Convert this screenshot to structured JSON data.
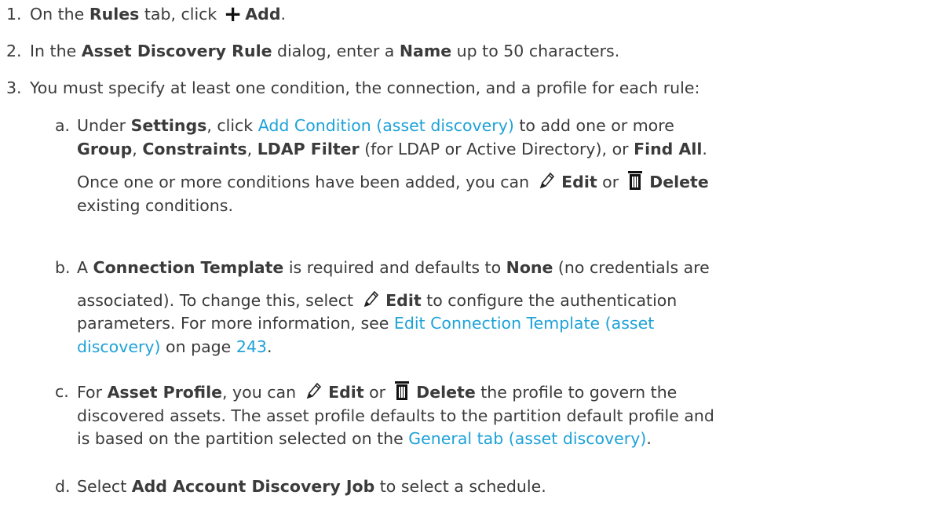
{
  "steps": [
    {
      "num": "1.",
      "pre": "On the ",
      "tab": "Rules",
      "mid": " tab, click ",
      "icon": "plus-icon",
      "action": "Add",
      "post": "."
    },
    {
      "num": "2.",
      "pre": "In the ",
      "dialog": "Asset Discovery Rule",
      "mid": " dialog, enter a ",
      "field": "Name",
      "post": " up to 50 characters."
    },
    {
      "num": "3.",
      "text": "You must specify at least one condition, the connection, and a profile for each rule:"
    }
  ],
  "sub_a": {
    "letter": "a.",
    "under": "Under ",
    "settings": "Settings",
    "click": ", click ",
    "link": "Add Condition (asset discovery)",
    "to_add": " to add one or more",
    "group": "Group",
    "comma1": ", ",
    "constraints": "Constraints",
    "comma2": ", ",
    "ldap": "LDAP Filter",
    "ldap_note": " (for LDAP or Active Directory), or ",
    "find_all": "Find All",
    "period": ".",
    "note_pre": " Once one or more conditions have been added, you can ",
    "icon_edit": "pencil-icon",
    "edit": "Edit",
    "or": " or ",
    "icon_delete": "trash-icon",
    "delete": "Delete",
    "note_post": "existing conditions."
  },
  "sub_b": {
    "letter": "b.",
    "a": "A ",
    "template": "Connection Template",
    "required": " is required and defaults to ",
    "none": "None",
    "no_creds": " (no credentials are",
    "assoc": "associated). To change this, select ",
    "icon_edit": "pencil-icon",
    "edit": "Edit",
    "configure": " to configure the authentication",
    "params": "parameters. For more information, see ",
    "link1": "Edit Connection Template (asset",
    "link2": "discovery)",
    "on_page": " on page ",
    "page": "243",
    "period": "."
  },
  "sub_c": {
    "letter": "c.",
    "for": "For ",
    "profile": "Asset Profile",
    "you_can": ", you can ",
    "icon_edit": "pencil-icon",
    "edit": "Edit",
    "or": " or ",
    "icon_delete": "trash-icon",
    "delete": "Delete",
    "govern": " the profile to govern the",
    "line2": "discovered assets. The asset profile defaults to the partition default profile and",
    "line3_pre": "is based on the partition selected on the ",
    "link": "General tab (asset discovery)",
    "period": "."
  },
  "sub_d": {
    "letter": "d.",
    "select": "Select ",
    "job": "Add Account Discovery Job",
    "post": " to select a schedule."
  }
}
